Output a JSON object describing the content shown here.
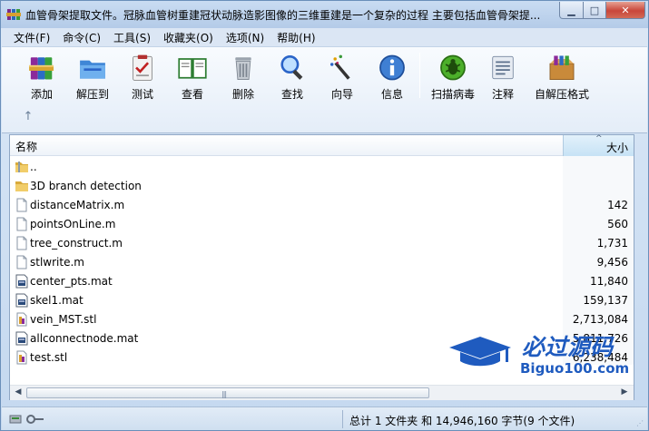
{
  "window": {
    "title": "血管骨架提取文件。冠脉血管树重建冠状动脉造影图像的三维重建是一个复杂的过程 主要包括血管骨架提..."
  },
  "titlebar_buttons": {
    "minimize_icon": "minimize-icon",
    "maximize_icon": "maximize-icon",
    "close_icon": "close-icon"
  },
  "menu": [
    {
      "label": "文件(F)"
    },
    {
      "label": "命令(C)"
    },
    {
      "label": "工具(S)"
    },
    {
      "label": "收藏夹(O)"
    },
    {
      "label": "选项(N)"
    },
    {
      "label": "帮助(H)"
    }
  ],
  "toolbar": [
    {
      "label": "添加",
      "icon": "add-archive-icon"
    },
    {
      "label": "解压到",
      "icon": "extract-folder-icon"
    },
    {
      "label": "测试",
      "icon": "test-clipboard-icon"
    },
    {
      "label": "查看",
      "icon": "view-book-icon"
    },
    {
      "label": "删除",
      "icon": "trash-icon"
    },
    {
      "label": "查找",
      "icon": "magnifier-icon"
    },
    {
      "label": "向导",
      "icon": "wizard-wand-icon"
    },
    {
      "label": "信息",
      "icon": "info-icon"
    },
    {
      "label": "扫描病毒",
      "icon": "virus-scan-icon"
    },
    {
      "label": "注释",
      "icon": "comment-icon"
    },
    {
      "label": "自解压格式",
      "icon": "sfx-box-icon"
    }
  ],
  "list": {
    "col_name": "名称",
    "col_size": "大小",
    "rows": [
      {
        "name": "..",
        "size": "",
        "type": "parent"
      },
      {
        "name": "3D branch detection",
        "size": "",
        "type": "folder"
      },
      {
        "name": "distanceMatrix.m",
        "size": "142",
        "type": "file"
      },
      {
        "name": "pointsOnLine.m",
        "size": "560",
        "type": "file"
      },
      {
        "name": "tree_construct.m",
        "size": "1,731",
        "type": "file"
      },
      {
        "name": "stlwrite.m",
        "size": "9,456",
        "type": "file"
      },
      {
        "name": "center_pts.mat",
        "size": "11,840",
        "type": "mat"
      },
      {
        "name": "skel1.mat",
        "size": "159,137",
        "type": "mat"
      },
      {
        "name": "vein_MST.stl",
        "size": "2,713,084",
        "type": "stl"
      },
      {
        "name": "allconnectnode.mat",
        "size": "5,811,726",
        "type": "mat"
      },
      {
        "name": "test.stl",
        "size": "6,238,484",
        "type": "stl"
      }
    ]
  },
  "status": {
    "text": "总计 1 文件夹 和 14,946,160 字节(9 个文件)"
  },
  "watermark": {
    "brand": "必过源码",
    "domain": "Biguo100.com"
  },
  "colors": {
    "accent": "#2a64c8",
    "folder": "#e8b84a",
    "header_sorted": "#c6e2f5"
  }
}
